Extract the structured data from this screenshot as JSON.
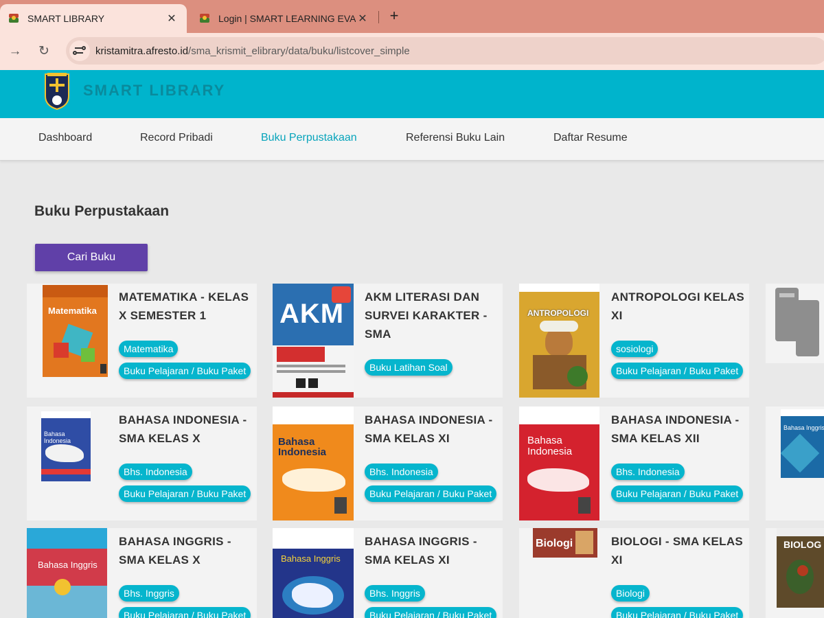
{
  "browser": {
    "tabs": [
      {
        "title": "SMART LIBRARY",
        "active": true
      },
      {
        "title": "Login | SMART LEARNING EVAL",
        "active": false
      }
    ],
    "new_tab_icon": "+",
    "close_icon": "✕",
    "url_host": "kristamitra.afresto.id",
    "url_path": "/sma_krismit_elibrary/data/buku/listcover_simple"
  },
  "header": {
    "brand": "SMART LIBRARY",
    "accent": "#00b4cc"
  },
  "menu": [
    {
      "label": "Dashboard",
      "active": false
    },
    {
      "label": "Record Pribadi",
      "active": false
    },
    {
      "label": "Buku Perpustakaan",
      "active": true
    },
    {
      "label": "Referensi Buku Lain",
      "active": false
    },
    {
      "label": "Daftar Resume",
      "active": false
    }
  ],
  "page": {
    "title": "Buku Perpustakaan",
    "search_button": "Cari Buku"
  },
  "books": [
    {
      "title": "MATEMATIKA - KELAS X SEMESTER 1",
      "tags": [
        "Matematika",
        "Buku Pelajaran / Buku Paket"
      ],
      "cover_text": "Matematika"
    },
    {
      "title": "AKM LITERASI DAN SURVEI KARAKTER - SMA",
      "tags": [
        "Buku Latihan Soal"
      ],
      "cover_text": "AKM"
    },
    {
      "title": "ANTROPOLOGI KELAS XI",
      "tags": [
        "sosiologi",
        "Buku Pelajaran / Buku Paket"
      ],
      "cover_text": "ANTROPOLOGI"
    },
    {
      "title": "BAHASA INDONESIA - SMA KELAS X",
      "tags": [
        "Bhs. Indonesia",
        "Buku Pelajaran / Buku Paket"
      ],
      "cover_text": "Bahasa Indonesia"
    },
    {
      "title": "BAHASA INDONESIA - SMA KELAS XI",
      "tags": [
        "Bhs. Indonesia",
        "Buku Pelajaran / Buku Paket"
      ],
      "cover_text": "Bahasa Indonesia"
    },
    {
      "title": "BAHASA INDONESIA - SMA KELAS XII",
      "tags": [
        "Bhs. Indonesia",
        "Buku Pelajaran / Buku Paket"
      ],
      "cover_text": "Bahasa Indonesia"
    },
    {
      "title": "BAHASA INGGRIS - SMA KELAS X",
      "tags": [
        "Bhs. Inggris",
        "Buku Pelajaran / Buku Paket"
      ],
      "cover_text": "Bahasa Inggris"
    },
    {
      "title": "BAHASA INGGRIS - SMA KELAS XI",
      "tags": [
        "Bhs. Inggris",
        "Buku Pelajaran / Buku Paket"
      ],
      "cover_text": "Bahasa Inggris"
    },
    {
      "title": "BIOLOGI - SMA KELAS XI",
      "tags": [
        "Biologi",
        "Buku Pelajaran / Buku Paket"
      ],
      "cover_text": "Biologi"
    }
  ],
  "partial_covers": [
    "",
    "Bahasa Inggris",
    "BIOLOG"
  ]
}
